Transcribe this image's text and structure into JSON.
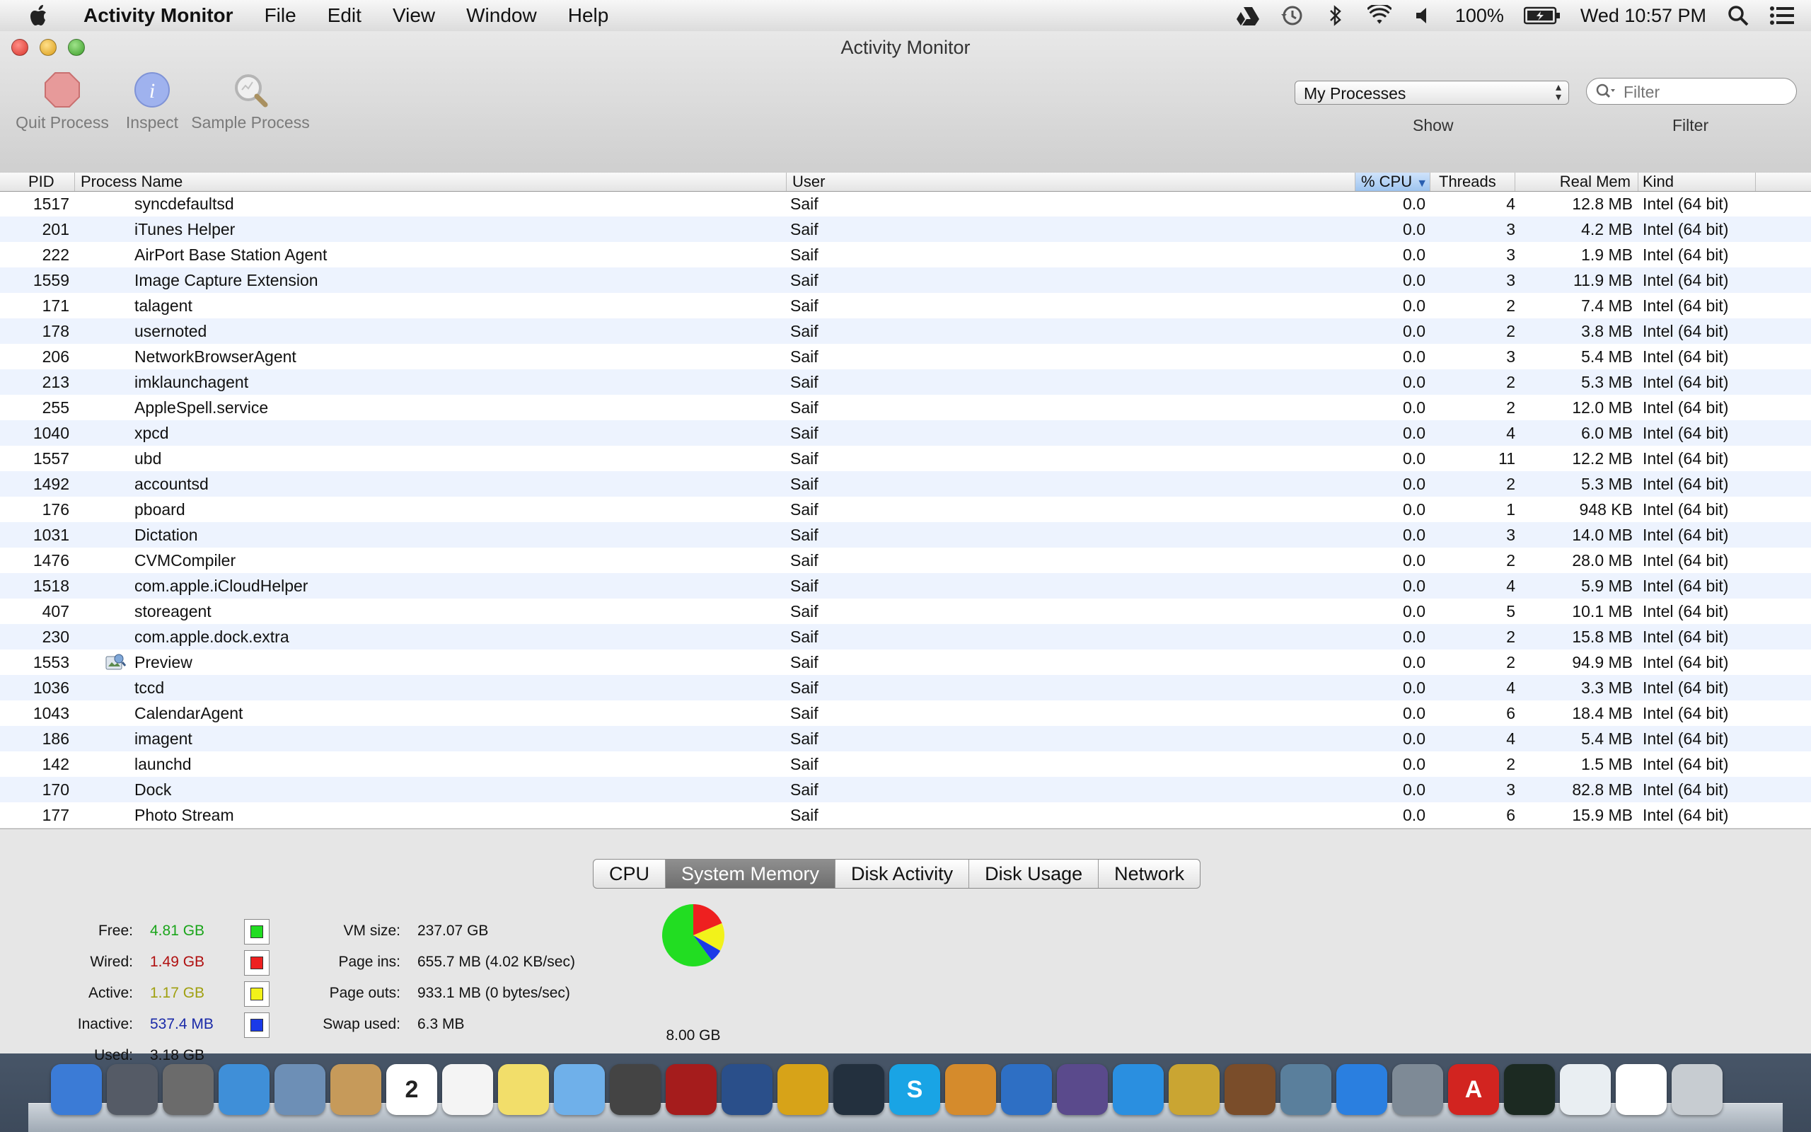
{
  "menubar": {
    "app_name": "Activity Monitor",
    "items": [
      "File",
      "Edit",
      "View",
      "Window",
      "Help"
    ],
    "battery": "100%",
    "clock": "Wed 10:57 PM"
  },
  "window": {
    "title": "Activity Monitor",
    "toolbar": {
      "quit_label": "Quit Process",
      "inspect_label": "Inspect",
      "sample_label": "Sample Process"
    },
    "show": {
      "selected": "My Processes",
      "label": "Show"
    },
    "filter": {
      "placeholder": "Filter",
      "label": "Filter"
    }
  },
  "table": {
    "columns": {
      "pid": "PID",
      "name": "Process Name",
      "user": "User",
      "cpu": "% CPU",
      "threads": "Threads",
      "mem": "Real Mem",
      "kind": "Kind"
    },
    "sorted_column": "cpu",
    "rows": [
      {
        "pid": "1517",
        "name": "syncdefaultsd",
        "user": "Saif",
        "cpu": "0.0",
        "threads": "4",
        "mem": "12.8 MB",
        "kind": "Intel (64 bit)"
      },
      {
        "pid": "201",
        "name": "iTunes Helper",
        "user": "Saif",
        "cpu": "0.0",
        "threads": "3",
        "mem": "4.2 MB",
        "kind": "Intel (64 bit)"
      },
      {
        "pid": "222",
        "name": "AirPort Base Station Agent",
        "user": "Saif",
        "cpu": "0.0",
        "threads": "3",
        "mem": "1.9 MB",
        "kind": "Intel (64 bit)"
      },
      {
        "pid": "1559",
        "name": "Image Capture Extension",
        "user": "Saif",
        "cpu": "0.0",
        "threads": "3",
        "mem": "11.9 MB",
        "kind": "Intel (64 bit)"
      },
      {
        "pid": "171",
        "name": "talagent",
        "user": "Saif",
        "cpu": "0.0",
        "threads": "2",
        "mem": "7.4 MB",
        "kind": "Intel (64 bit)"
      },
      {
        "pid": "178",
        "name": "usernoted",
        "user": "Saif",
        "cpu": "0.0",
        "threads": "2",
        "mem": "3.8 MB",
        "kind": "Intel (64 bit)"
      },
      {
        "pid": "206",
        "name": "NetworkBrowserAgent",
        "user": "Saif",
        "cpu": "0.0",
        "threads": "3",
        "mem": "5.4 MB",
        "kind": "Intel (64 bit)"
      },
      {
        "pid": "213",
        "name": "imklaunchagent",
        "user": "Saif",
        "cpu": "0.0",
        "threads": "2",
        "mem": "5.3 MB",
        "kind": "Intel (64 bit)"
      },
      {
        "pid": "255",
        "name": "AppleSpell.service",
        "user": "Saif",
        "cpu": "0.0",
        "threads": "2",
        "mem": "12.0 MB",
        "kind": "Intel (64 bit)"
      },
      {
        "pid": "1040",
        "name": "xpcd",
        "user": "Saif",
        "cpu": "0.0",
        "threads": "4",
        "mem": "6.0 MB",
        "kind": "Intel (64 bit)"
      },
      {
        "pid": "1557",
        "name": "ubd",
        "user": "Saif",
        "cpu": "0.0",
        "threads": "11",
        "mem": "12.2 MB",
        "kind": "Intel (64 bit)"
      },
      {
        "pid": "1492",
        "name": "accountsd",
        "user": "Saif",
        "cpu": "0.0",
        "threads": "2",
        "mem": "5.3 MB",
        "kind": "Intel (64 bit)"
      },
      {
        "pid": "176",
        "name": "pboard",
        "user": "Saif",
        "cpu": "0.0",
        "threads": "1",
        "mem": "948 KB",
        "kind": "Intel (64 bit)"
      },
      {
        "pid": "1031",
        "name": "Dictation",
        "user": "Saif",
        "cpu": "0.0",
        "threads": "3",
        "mem": "14.0 MB",
        "kind": "Intel (64 bit)"
      },
      {
        "pid": "1476",
        "name": "CVMCompiler",
        "user": "Saif",
        "cpu": "0.0",
        "threads": "2",
        "mem": "28.0 MB",
        "kind": "Intel (64 bit)"
      },
      {
        "pid": "1518",
        "name": "com.apple.iCloudHelper",
        "user": "Saif",
        "cpu": "0.0",
        "threads": "4",
        "mem": "5.9 MB",
        "kind": "Intel (64 bit)"
      },
      {
        "pid": "407",
        "name": "storeagent",
        "user": "Saif",
        "cpu": "0.0",
        "threads": "5",
        "mem": "10.1 MB",
        "kind": "Intel (64 bit)"
      },
      {
        "pid": "230",
        "name": "com.apple.dock.extra",
        "user": "Saif",
        "cpu": "0.0",
        "threads": "2",
        "mem": "15.8 MB",
        "kind": "Intel (64 bit)"
      },
      {
        "pid": "1553",
        "name": "Preview",
        "user": "Saif",
        "cpu": "0.0",
        "threads": "2",
        "mem": "94.9 MB",
        "kind": "Intel (64 bit)",
        "icon": "preview-icon"
      },
      {
        "pid": "1036",
        "name": "tccd",
        "user": "Saif",
        "cpu": "0.0",
        "threads": "4",
        "mem": "3.3 MB",
        "kind": "Intel (64 bit)"
      },
      {
        "pid": "1043",
        "name": "CalendarAgent",
        "user": "Saif",
        "cpu": "0.0",
        "threads": "6",
        "mem": "18.4 MB",
        "kind": "Intel (64 bit)"
      },
      {
        "pid": "186",
        "name": "imagent",
        "user": "Saif",
        "cpu": "0.0",
        "threads": "4",
        "mem": "5.4 MB",
        "kind": "Intel (64 bit)"
      },
      {
        "pid": "142",
        "name": "launchd",
        "user": "Saif",
        "cpu": "0.0",
        "threads": "2",
        "mem": "1.5 MB",
        "kind": "Intel (64 bit)"
      },
      {
        "pid": "170",
        "name": "Dock",
        "user": "Saif",
        "cpu": "0.0",
        "threads": "3",
        "mem": "82.8 MB",
        "kind": "Intel (64 bit)"
      },
      {
        "pid": "177",
        "name": "Photo Stream",
        "user": "Saif",
        "cpu": "0.0",
        "threads": "6",
        "mem": "15.9 MB",
        "kind": "Intel (64 bit)"
      }
    ]
  },
  "bottom": {
    "tabs": [
      "CPU",
      "System Memory",
      "Disk Activity",
      "Disk Usage",
      "Network"
    ],
    "active_tab": "System Memory",
    "memory": {
      "free": {
        "label": "Free:",
        "value": "4.81 GB",
        "color": "#1aa51a",
        "swatch": "#22dd22"
      },
      "wired": {
        "label": "Wired:",
        "value": "1.49 GB",
        "color": "#b01010",
        "swatch": "#ee2020"
      },
      "active": {
        "label": "Active:",
        "value": "1.17 GB",
        "color": "#a0a010",
        "swatch": "#f2f21a"
      },
      "inactive": {
        "label": "Inactive:",
        "value": "537.4 MB",
        "color": "#1a2aa8",
        "swatch": "#1a3ae8"
      },
      "used": {
        "label": "Used:",
        "value": "3.18 GB"
      }
    },
    "vm": {
      "size": {
        "label": "VM size:",
        "value": "237.07 GB"
      },
      "page_ins": {
        "label": "Page ins:",
        "value": "655.7 MB (4.02 KB/sec)"
      },
      "page_outs": {
        "label": "Page outs:",
        "value": "933.1 MB (0 bytes/sec)"
      },
      "swap": {
        "label": "Swap used:",
        "value": "6.3 MB"
      }
    },
    "total": "8.00 GB"
  },
  "dock": {
    "items": [
      "finder-icon",
      "launchpad-icon",
      "mission-control-icon",
      "safari-icon",
      "mail-icon",
      "contacts-icon",
      "calendar-icon",
      "reminders-icon",
      "notes-icon",
      "messages-icon",
      "facetime-icon",
      "photo-booth-icon",
      "bus-driver-icon",
      "game-icon",
      "dashboard-icon",
      "skype-icon",
      "keynote-icon",
      "charts-icon",
      "pen-icon",
      "itunes-icon",
      "imovie-icon",
      "garageband-icon",
      "iphoto-icon",
      "app-store-icon",
      "system-preferences-icon",
      "acrobat-icon",
      "activity-monitor-icon",
      "preview-doc-icon",
      "document-icon",
      "trash-icon"
    ],
    "calendar_day": "2"
  }
}
